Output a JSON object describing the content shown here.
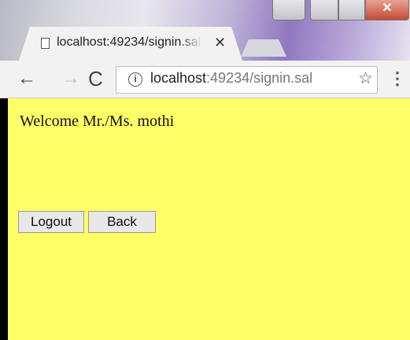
{
  "browser": {
    "tab": {
      "title": "localhost:49234/signin.sal",
      "close": "✕"
    },
    "window_buttons": {
      "close": "✕"
    },
    "toolbar": {
      "back": "←",
      "forward": "→",
      "reload": "C",
      "info": "i",
      "url_host": "localhost",
      "url_rest": ":49234/signin.sal",
      "star": "☆",
      "menu": "⋮"
    }
  },
  "page": {
    "background": "#ffff66",
    "welcome": "Welcome Mr./Ms. mothi",
    "buttons": {
      "logout": "Logout",
      "back": "Back"
    }
  }
}
